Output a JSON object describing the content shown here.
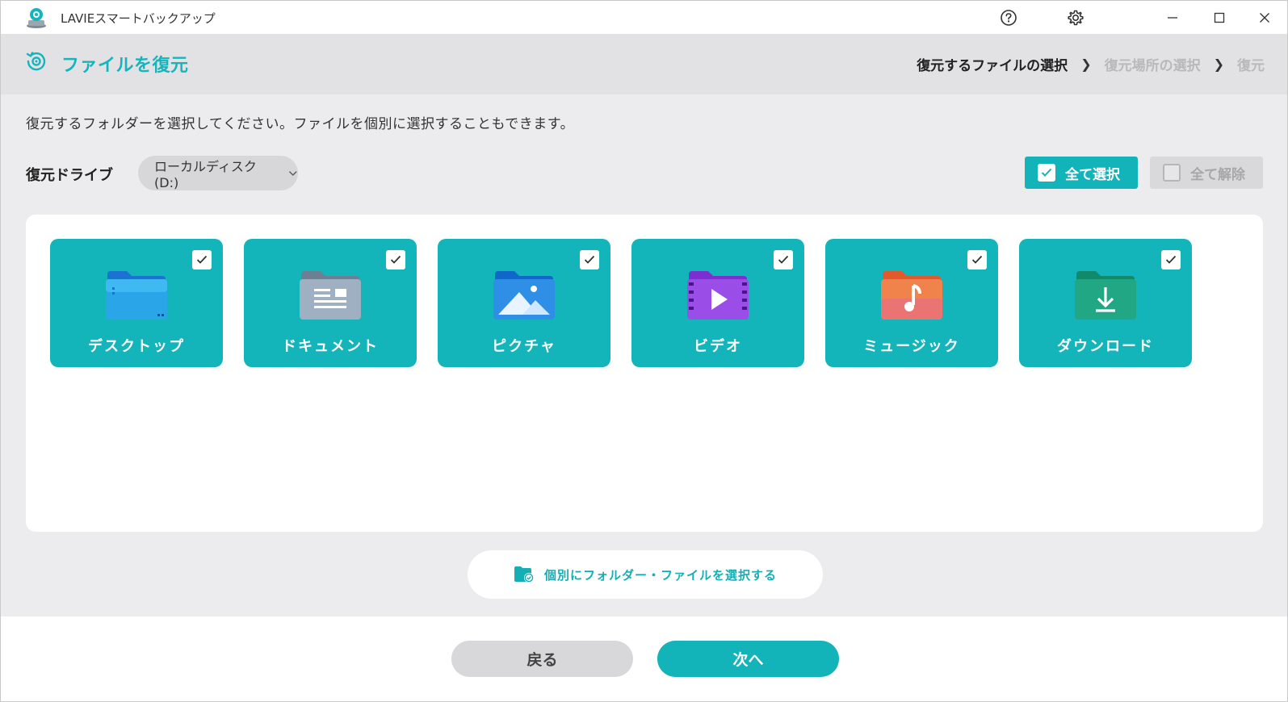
{
  "window": {
    "title": "LAVIEスマートバックアップ"
  },
  "header": {
    "page_title": "ファイルを復元",
    "steps": [
      {
        "label": "復元するファイルの選択",
        "active": true
      },
      {
        "label": "復元場所の選択",
        "active": false
      },
      {
        "label": "復元",
        "active": false
      }
    ]
  },
  "main": {
    "instruction": "復元するフォルダーを選択してください。ファイルを個別に選択することもできます。",
    "drive_label": "復元ドライブ",
    "drive_value": "ローカルディスク (D:)",
    "select_all_label": "全て選択",
    "deselect_all_label": "全て解除",
    "folders": [
      {
        "label": "デスクトップ",
        "icon": "desktop-folder-icon",
        "checked": true
      },
      {
        "label": "ドキュメント",
        "icon": "documents-folder-icon",
        "checked": true
      },
      {
        "label": "ピクチャ",
        "icon": "pictures-folder-icon",
        "checked": true
      },
      {
        "label": "ビデオ",
        "icon": "videos-folder-icon",
        "checked": true
      },
      {
        "label": "ミュージック",
        "icon": "music-folder-icon",
        "checked": true
      },
      {
        "label": "ダウンロード",
        "icon": "downloads-folder-icon",
        "checked": true
      }
    ],
    "individual_select_label": "個別にフォルダー・ファイルを選択する"
  },
  "footer": {
    "back_label": "戻る",
    "next_label": "次へ"
  },
  "colors": {
    "accent": "#12b3b9",
    "header_bg": "#e2e2e4",
    "body_bg": "#ececee"
  }
}
